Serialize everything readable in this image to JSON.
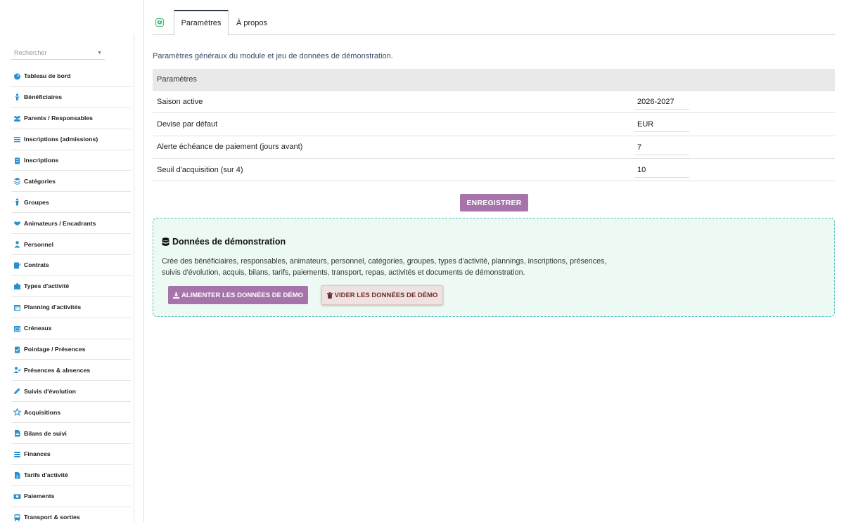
{
  "sidebar": {
    "search_placeholder": "Rechercher",
    "items": [
      {
        "label": "Tableau de bord",
        "icon": "dashboard-icon"
      },
      {
        "label": "Bénéficiaires",
        "icon": "child-icon"
      },
      {
        "label": "Parents / Responsables",
        "icon": "users-icon"
      },
      {
        "label": "Inscriptions (admissions)",
        "icon": "list-icon"
      },
      {
        "label": "Inscriptions",
        "icon": "clipboard-icon"
      },
      {
        "label": "Catégories",
        "icon": "layers-icon"
      },
      {
        "label": "Groupes",
        "icon": "group-icon"
      },
      {
        "label": "Animateurs / Encadrants",
        "icon": "handshake-icon"
      },
      {
        "label": "Personnel",
        "icon": "user-icon"
      },
      {
        "label": "Contrats",
        "icon": "contract-icon"
      },
      {
        "label": "Types d'activité",
        "icon": "puzzle-icon"
      },
      {
        "label": "Planning d'activités",
        "icon": "calendar-icon"
      },
      {
        "label": "Créneaux",
        "icon": "calendar-slot-icon"
      },
      {
        "label": "Pointage / Présences",
        "icon": "clipboard-check-icon"
      },
      {
        "label": "Présences & absences",
        "icon": "user-check-icon"
      },
      {
        "label": "Suivis d'évolution",
        "icon": "pencil-icon"
      },
      {
        "label": "Acquisitions",
        "icon": "star-icon"
      },
      {
        "label": "Bilans de suivi",
        "icon": "file-icon"
      },
      {
        "label": "Finances",
        "icon": "coins-icon"
      },
      {
        "label": "Tarifs d'activité",
        "icon": "price-file-icon"
      },
      {
        "label": "Paiements",
        "icon": "money-icon"
      },
      {
        "label": "Transport & sorties",
        "icon": "bus-icon"
      }
    ]
  },
  "tabs": {
    "active": "Paramètres",
    "about": "À propos"
  },
  "intro": "Paramètres généraux du module et jeu de données de démonstration.",
  "params": {
    "header": "Paramètres",
    "rows": [
      {
        "label": "Saison active",
        "value": "2026-2027"
      },
      {
        "label": "Devise par défaut",
        "value": "EUR"
      },
      {
        "label": "Alerte échéance de paiement (jours avant)",
        "value": "7"
      },
      {
        "label": "Seuil d'acquisition (sur 4)",
        "value": "10"
      }
    ],
    "save_label": "ENREGISTRER"
  },
  "demo": {
    "title": "Données de démonstration",
    "description": "Crée des bénéficiaires, responsables, animateurs, personnel, catégories, groupes, types d'activité, plannings, inscriptions, présences, suivis d'évolution, acquis, bilans, tarifs, paiements, transport, repas, activités et documents de démonstration.",
    "feed_label": "ALIMENTER LES DONNÉES DE DÉMO",
    "clear_label": "VIDER LES DONNÉES DE DÉMO"
  },
  "colors": {
    "accent": "#a673ab",
    "sidebar_icon": "#2a8fcf",
    "demo_bg": "#ecfaf3",
    "demo_border": "#55bfc9",
    "clear_bg": "#efe2e0"
  }
}
